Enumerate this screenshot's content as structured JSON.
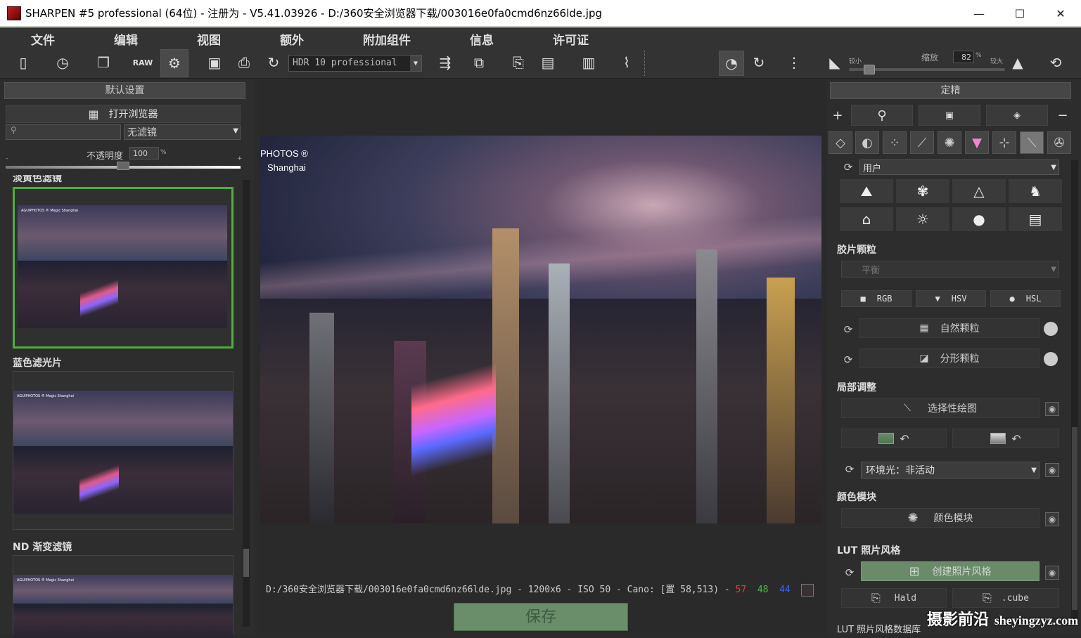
{
  "window": {
    "title": "SHARPEN #5 professional (64位) - 注册为 - V5.41.03926 - D:/360安全浏览器下载/003016e0fa0cmd6nz66lde.jpg",
    "minimize": "—",
    "maximize": "☐",
    "close": "✕"
  },
  "menu": [
    "文件",
    "编辑",
    "视图",
    "额外",
    "附加组件",
    "信息",
    "许可证"
  ],
  "toolbar": {
    "hdr_preset": "HDR 10 professional",
    "zoom_label": "缩放",
    "zoom_value": "82",
    "zoom_unit": "%",
    "zoom_min_label": "较小",
    "zoom_max_label": "较大",
    "zoom_level": 0.1
  },
  "left": {
    "header": "默认设置",
    "browser_button": "打开浏览器",
    "search_placeholder": "",
    "filter_value": "无滤镜",
    "opacity_label": "不透明度",
    "opacity_value": "100",
    "opacity_unit": "%",
    "opacity_min": "-",
    "opacity_max": "+",
    "presets": [
      {
        "label": "淡黄色滤镜",
        "selected": true
      },
      {
        "label": "蓝色滤光片",
        "selected": false
      },
      {
        "label": "ND 渐变滤镜",
        "selected": false
      }
    ],
    "thumb_watermark": "AGUIPHOTOS ® Magic Shanghai"
  },
  "center": {
    "image_watermark_1": "PHOTOS ®",
    "image_watermark_2": "Shanghai",
    "status_prefix": "D:/360安全浏览器下载/003016e0fa0cmd6nz66lde.jpg - 1200x6  - ISO 50 - Cano: [置 58,513) - ",
    "status_r": "57",
    "status_g": "48",
    "status_b": "44",
    "save_button": "保存"
  },
  "right": {
    "header": "定精",
    "user_select": "用户",
    "film_grain_title": "胶片颗粒",
    "grain_select": "平衡",
    "modes": [
      "RGB",
      "HSV",
      "HSL"
    ],
    "natural_grain": "自然颗粒",
    "fractal_grain": "分形颗粒",
    "local_adjust_title": "局部调整",
    "selective_draw": "选择性绘图",
    "ambient_light": "环境光：非活动",
    "color_module_title": "颜色模块",
    "color_module": "颜色模块",
    "lut_title": "LUT 照片风格",
    "create_style": "创建照片风格",
    "hald": "Hald",
    "cube": ".cube",
    "lut_db": "LUT 照片风格数据库"
  },
  "watermark": {
    "cn": "摄影前沿",
    "en": "sheyingzyz.com"
  },
  "colors": {
    "accent_green": "#4fae3a",
    "save_green": "#6a8d6a",
    "create_green": "#6a8a6a"
  }
}
